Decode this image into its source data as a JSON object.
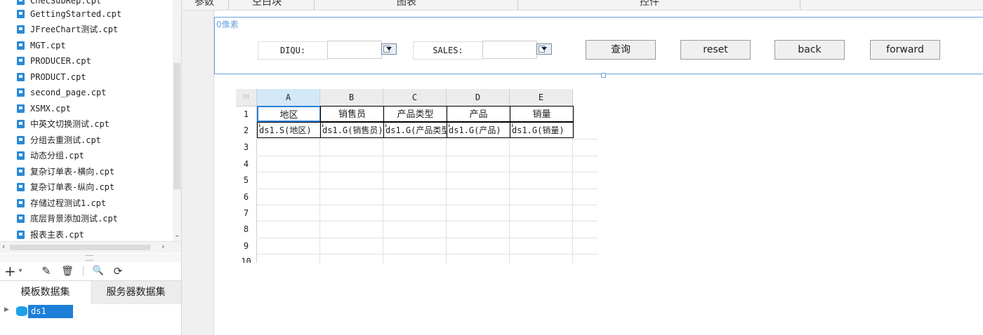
{
  "file_tree": {
    "files": [
      "GettingStarted.cpt",
      "JFreeChart测试.cpt",
      "MGT.cpt",
      "PRODUCER.cpt",
      "PRODUCT.cpt",
      "second_page.cpt",
      "XSMX.cpt",
      "中英文切换测试.cpt",
      "分组去重测试.cpt",
      "动态分组.cpt",
      "复杂订单表-横向.cpt",
      "复杂订单表-纵向.cpt",
      "存储过程测试1.cpt",
      "底层背景添加测试.cpt",
      "报表主表.cpt"
    ]
  },
  "left_toolbar": {
    "add": "+",
    "add_caret": "▾",
    "edit": "✎",
    "delete": "🗑",
    "preview": "🔍",
    "refresh": "⟳"
  },
  "dataset_tabs": [
    "模板数据集",
    "服务器数据集"
  ],
  "dataset_tree": {
    "items": [
      "ds1"
    ]
  },
  "top_bar": {
    "items": [
      "参数",
      "空白块",
      "图表",
      "控件"
    ]
  },
  "param_pane": {
    "pixel_label": "0像素",
    "fields": [
      {
        "label": "DIQU:",
        "value": ""
      },
      {
        "label": "SALES:",
        "value": ""
      }
    ],
    "buttons": [
      "查询",
      "reset",
      "back",
      "forward"
    ]
  },
  "grid": {
    "columns": [
      "A",
      "B",
      "C",
      "D",
      "E"
    ],
    "rows": [
      "1",
      "2",
      "3",
      "4",
      "5",
      "6",
      "7",
      "8",
      "9",
      "10"
    ],
    "header_row": [
      "地区",
      "销售员",
      "产品类型",
      "产品",
      "销量"
    ],
    "data_row": [
      "ds1.S(地区)",
      "ds1.G(销售员)",
      "ds1.G(产品类型)",
      "ds1.G(产品)",
      "ds1.G(销量)"
    ],
    "data_marks": [
      "↓",
      "↓",
      "↓",
      "↓",
      "↓"
    ]
  }
}
